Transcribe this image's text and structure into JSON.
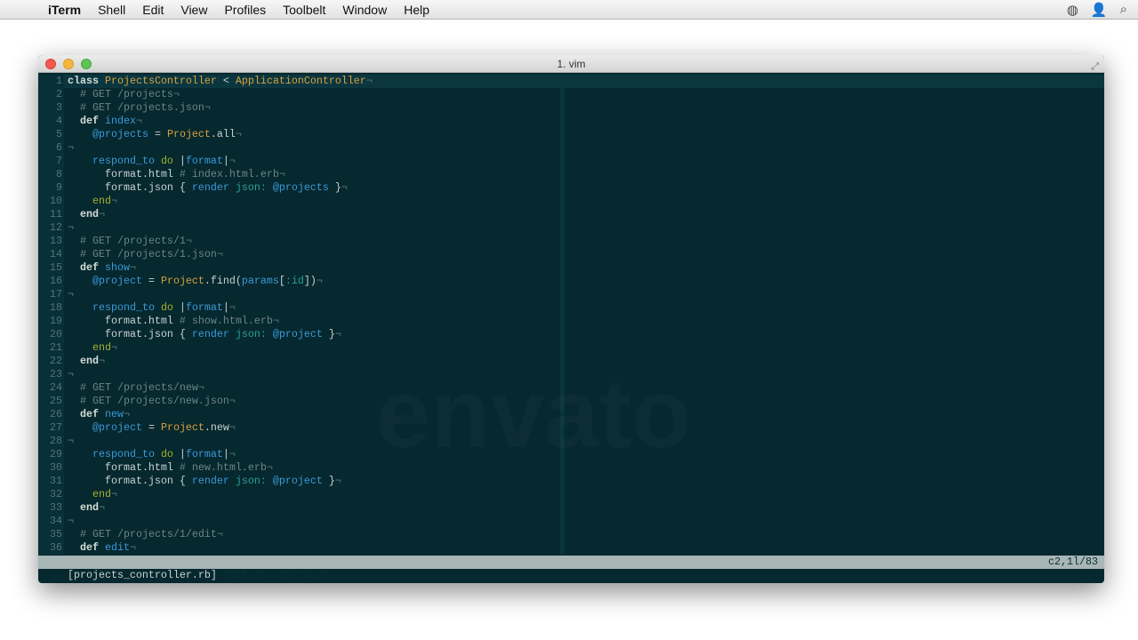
{
  "menubar": {
    "app": "iTerm",
    "items": [
      "Shell",
      "Edit",
      "View",
      "Profiles",
      "Toolbelt",
      "Window",
      "Help"
    ]
  },
  "window": {
    "title": "1. vim"
  },
  "watermark": "envato",
  "editor": {
    "lines": [
      [
        [
          "k",
          "class"
        ],
        [
          "n",
          " "
        ],
        [
          "c",
          "ProjectsController"
        ],
        [
          "n",
          " < "
        ],
        [
          "c",
          "ApplicationController"
        ],
        [
          "p",
          "¬"
        ]
      ],
      [
        [
          "n",
          "  "
        ],
        [
          "cm",
          "# GET /projects"
        ],
        [
          "p",
          "¬"
        ]
      ],
      [
        [
          "n",
          "  "
        ],
        [
          "cm",
          "# GET /projects.json"
        ],
        [
          "p",
          "¬"
        ]
      ],
      [
        [
          "n",
          "  "
        ],
        [
          "k",
          "def"
        ],
        [
          "n",
          " "
        ],
        [
          "m",
          "index"
        ],
        [
          "p",
          "¬"
        ]
      ],
      [
        [
          "n",
          "    "
        ],
        [
          "i",
          "@projects"
        ],
        [
          "n",
          " = "
        ],
        [
          "c",
          "Project"
        ],
        [
          "n",
          ".all"
        ],
        [
          "p",
          "¬"
        ]
      ],
      [
        [
          "p",
          "¬"
        ]
      ],
      [
        [
          "n",
          "    "
        ],
        [
          "m",
          "respond_to"
        ],
        [
          "n",
          " "
        ],
        [
          "d",
          "do"
        ],
        [
          "n",
          " |"
        ],
        [
          "i",
          "format"
        ],
        [
          "n",
          "|"
        ],
        [
          "p",
          "¬"
        ]
      ],
      [
        [
          "n",
          "      format.html "
        ],
        [
          "cm",
          "# index.html.erb"
        ],
        [
          "p",
          "¬"
        ]
      ],
      [
        [
          "n",
          "      format.json { "
        ],
        [
          "m",
          "render"
        ],
        [
          "n",
          " "
        ],
        [
          "s",
          "json:"
        ],
        [
          "n",
          " "
        ],
        [
          "i",
          "@projects"
        ],
        [
          "n",
          " }"
        ],
        [
          "p",
          "¬"
        ]
      ],
      [
        [
          "n",
          "    "
        ],
        [
          "d",
          "end"
        ],
        [
          "p",
          "¬"
        ]
      ],
      [
        [
          "n",
          "  "
        ],
        [
          "k",
          "end"
        ],
        [
          "p",
          "¬"
        ]
      ],
      [
        [
          "p",
          "¬"
        ]
      ],
      [
        [
          "n",
          "  "
        ],
        [
          "cm",
          "# GET /projects/1"
        ],
        [
          "p",
          "¬"
        ]
      ],
      [
        [
          "n",
          "  "
        ],
        [
          "cm",
          "# GET /projects/1.json"
        ],
        [
          "p",
          "¬"
        ]
      ],
      [
        [
          "n",
          "  "
        ],
        [
          "k",
          "def"
        ],
        [
          "n",
          " "
        ],
        [
          "m",
          "show"
        ],
        [
          "p",
          "¬"
        ]
      ],
      [
        [
          "n",
          "    "
        ],
        [
          "i",
          "@project"
        ],
        [
          "n",
          " = "
        ],
        [
          "c",
          "Project"
        ],
        [
          "n",
          ".find("
        ],
        [
          "m",
          "params"
        ],
        [
          "n",
          "["
        ],
        [
          "s",
          ":id"
        ],
        [
          "n",
          "])"
        ],
        [
          "p",
          "¬"
        ]
      ],
      [
        [
          "p",
          "¬"
        ]
      ],
      [
        [
          "n",
          "    "
        ],
        [
          "m",
          "respond_to"
        ],
        [
          "n",
          " "
        ],
        [
          "d",
          "do"
        ],
        [
          "n",
          " |"
        ],
        [
          "i",
          "format"
        ],
        [
          "n",
          "|"
        ],
        [
          "p",
          "¬"
        ]
      ],
      [
        [
          "n",
          "      format.html "
        ],
        [
          "cm",
          "# show.html.erb"
        ],
        [
          "p",
          "¬"
        ]
      ],
      [
        [
          "n",
          "      format.json { "
        ],
        [
          "m",
          "render"
        ],
        [
          "n",
          " "
        ],
        [
          "s",
          "json:"
        ],
        [
          "n",
          " "
        ],
        [
          "i",
          "@project"
        ],
        [
          "n",
          " }"
        ],
        [
          "p",
          "¬"
        ]
      ],
      [
        [
          "n",
          "    "
        ],
        [
          "d",
          "end"
        ],
        [
          "p",
          "¬"
        ]
      ],
      [
        [
          "n",
          "  "
        ],
        [
          "k",
          "end"
        ],
        [
          "p",
          "¬"
        ]
      ],
      [
        [
          "p",
          "¬"
        ]
      ],
      [
        [
          "n",
          "  "
        ],
        [
          "cm",
          "# GET /projects/new"
        ],
        [
          "p",
          "¬"
        ]
      ],
      [
        [
          "n",
          "  "
        ],
        [
          "cm",
          "# GET /projects/new.json"
        ],
        [
          "p",
          "¬"
        ]
      ],
      [
        [
          "n",
          "  "
        ],
        [
          "k",
          "def"
        ],
        [
          "n",
          " "
        ],
        [
          "m",
          "new"
        ],
        [
          "p",
          "¬"
        ]
      ],
      [
        [
          "n",
          "    "
        ],
        [
          "i",
          "@project"
        ],
        [
          "n",
          " = "
        ],
        [
          "c",
          "Project"
        ],
        [
          "n",
          ".new"
        ],
        [
          "p",
          "¬"
        ]
      ],
      [
        [
          "p",
          "¬"
        ]
      ],
      [
        [
          "n",
          "    "
        ],
        [
          "m",
          "respond_to"
        ],
        [
          "n",
          " "
        ],
        [
          "d",
          "do"
        ],
        [
          "n",
          " |"
        ],
        [
          "i",
          "format"
        ],
        [
          "n",
          "|"
        ],
        [
          "p",
          "¬"
        ]
      ],
      [
        [
          "n",
          "      format.html "
        ],
        [
          "cm",
          "# new.html.erb"
        ],
        [
          "p",
          "¬"
        ]
      ],
      [
        [
          "n",
          "      format.json { "
        ],
        [
          "m",
          "render"
        ],
        [
          "n",
          " "
        ],
        [
          "s",
          "json:"
        ],
        [
          "n",
          " "
        ],
        [
          "i",
          "@project"
        ],
        [
          "n",
          " }"
        ],
        [
          "p",
          "¬"
        ]
      ],
      [
        [
          "n",
          "    "
        ],
        [
          "d",
          "end"
        ],
        [
          "p",
          "¬"
        ]
      ],
      [
        [
          "n",
          "  "
        ],
        [
          "k",
          "end"
        ],
        [
          "p",
          "¬"
        ]
      ],
      [
        [
          "p",
          "¬"
        ]
      ],
      [
        [
          "n",
          "  "
        ],
        [
          "cm",
          "# GET /projects/1/edit"
        ],
        [
          "p",
          "¬"
        ]
      ],
      [
        [
          "n",
          "  "
        ],
        [
          "k",
          "def"
        ],
        [
          "n",
          " "
        ],
        [
          "m",
          "edit"
        ],
        [
          "p",
          "¬"
        ]
      ]
    ]
  },
  "status": {
    "filename": "[projects_controller.rb]",
    "info": "[utf-8|unix|ruby]",
    "position": "c2,1l/83"
  }
}
